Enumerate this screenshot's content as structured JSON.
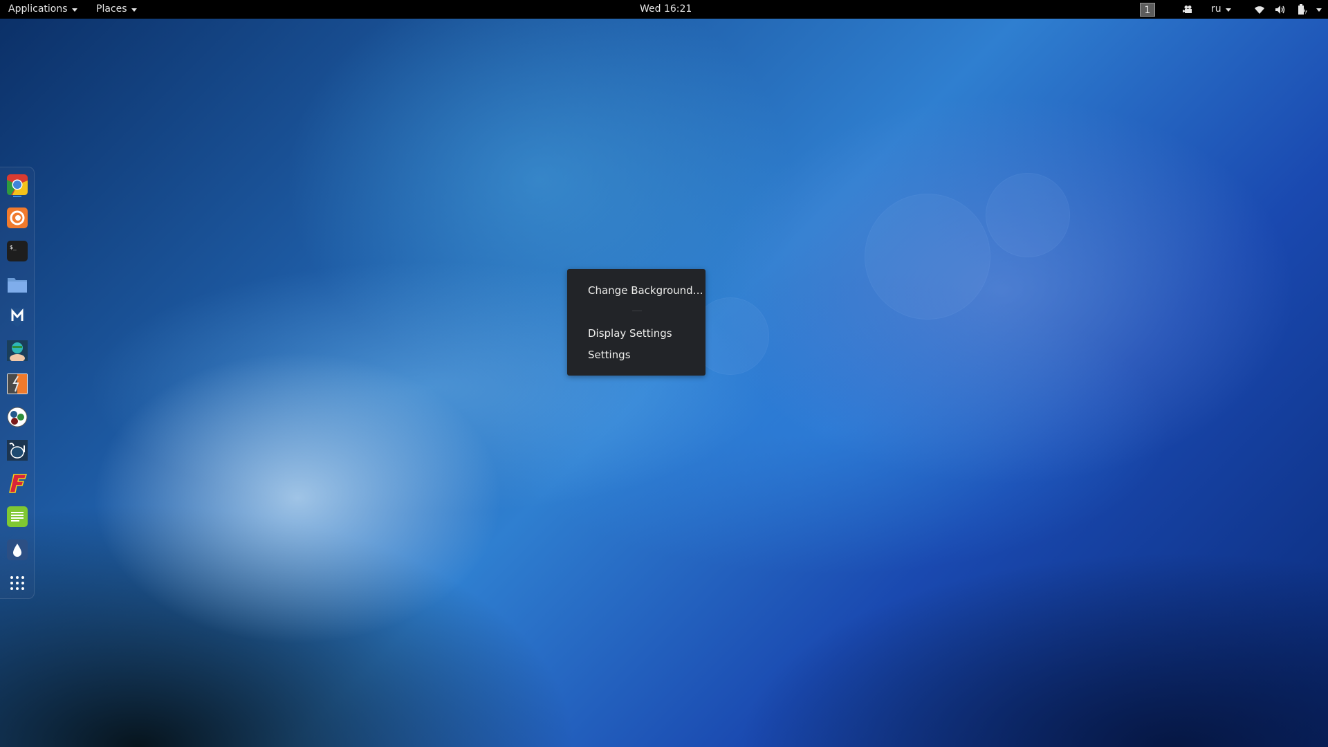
{
  "topbar": {
    "applications_label": "Applications",
    "places_label": "Places",
    "clock": "Wed 16:21",
    "workspace_number": "1",
    "keyboard_layout": "ru"
  },
  "context_menu": {
    "items": [
      {
        "label": "Change Background…"
      },
      {
        "label": "Display Settings"
      },
      {
        "label": "Settings"
      }
    ]
  },
  "dock": {
    "items": [
      {
        "name": "Google Chrome",
        "icon": "chrome-icon",
        "running": true
      },
      {
        "name": "Firefox",
        "icon": "firefox-icon"
      },
      {
        "name": "Terminal",
        "icon": "terminal-icon",
        "glyph": "$_"
      },
      {
        "name": "Files",
        "icon": "folder-icon"
      },
      {
        "name": "Metasploit",
        "icon": "metasploit-icon",
        "glyph": "M"
      },
      {
        "name": "Armitage",
        "icon": "armitage-icon"
      },
      {
        "name": "Burp Suite",
        "icon": "burpsuite-icon"
      },
      {
        "name": "Maltego",
        "icon": "maltego-icon"
      },
      {
        "name": "BeEF",
        "icon": "beef-icon"
      },
      {
        "name": "Faraday",
        "icon": "faraday-icon",
        "glyph": "F"
      },
      {
        "name": "Text Editor",
        "icon": "text-editor-icon"
      },
      {
        "name": "Fluid",
        "icon": "drop-icon"
      },
      {
        "name": "Show Applications",
        "icon": "app-grid-icon"
      }
    ]
  }
}
